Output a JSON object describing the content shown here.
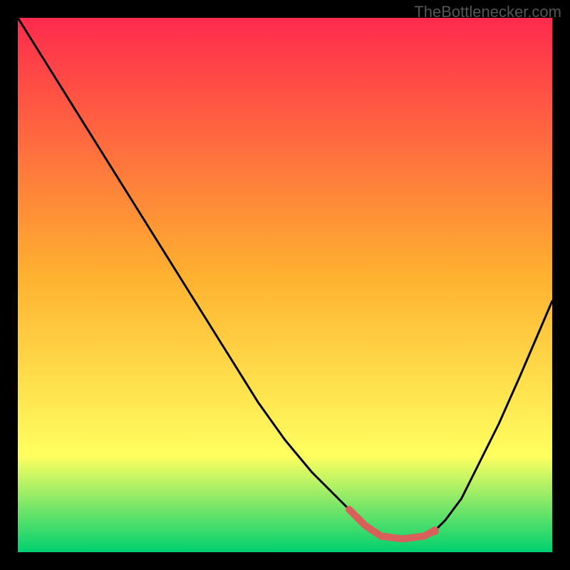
{
  "watermark": "TheBottlenecker.com",
  "chart_data": {
    "type": "line",
    "title": "",
    "xlabel": "",
    "ylabel": "",
    "xlim": [
      0,
      100
    ],
    "ylim": [
      0,
      100
    ],
    "gradient_colors": {
      "top": "#ff2a4d",
      "mid_upper": "#ffb030",
      "mid_lower": "#ffff60",
      "bottom": "#00d070"
    },
    "curve": {
      "description": "Bottleneck curve: high at left, descending to a minimum plateau near x≈68–78, then rising again to the right",
      "x": [
        0,
        5,
        10,
        15,
        20,
        25,
        30,
        35,
        40,
        45,
        50,
        55,
        60,
        62,
        65,
        68,
        72,
        76,
        78,
        80,
        83,
        86,
        90,
        94,
        97,
        100
      ],
      "y": [
        100,
        92,
        84,
        76,
        68,
        60,
        52,
        44,
        36,
        28,
        21,
        15,
        10,
        8,
        5,
        3,
        2.5,
        3,
        4,
        6,
        10,
        16,
        24,
        33,
        40,
        47
      ]
    },
    "optimal_band": {
      "x_start": 62,
      "x_end": 78,
      "y": 3,
      "marker_color": "#d9605a"
    }
  }
}
